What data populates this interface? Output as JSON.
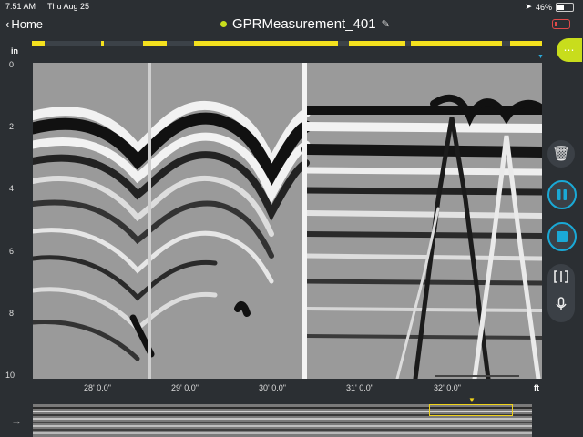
{
  "status_bar": {
    "time": "7:51 AM",
    "date": "Thu Aug 25",
    "battery_percent": "46%"
  },
  "nav": {
    "back_label": "Home",
    "title": "GPRMeasurement_401"
  },
  "menu": {
    "more_label": "⋯"
  },
  "scan": {
    "depth_unit": "in",
    "distance_unit": "ft",
    "depth_ticks": [
      "0",
      "2",
      "4",
      "6",
      "8",
      "10"
    ],
    "distance_ticks": [
      "28' 0.0\"",
      "29' 0.0\"",
      "30' 0.0\"",
      "31' 0.0\"",
      "32' 0.0\""
    ]
  },
  "colors": {
    "accent": "#1aa9d6",
    "marker": "#f4e11e",
    "recording": "#c8dd1c",
    "alert": "#e04a4a"
  },
  "icons": {
    "trash": "trash-icon",
    "pause": "pause-icon",
    "stop": "stop-icon",
    "split": "split-view-icon",
    "mic": "microphone-icon"
  }
}
